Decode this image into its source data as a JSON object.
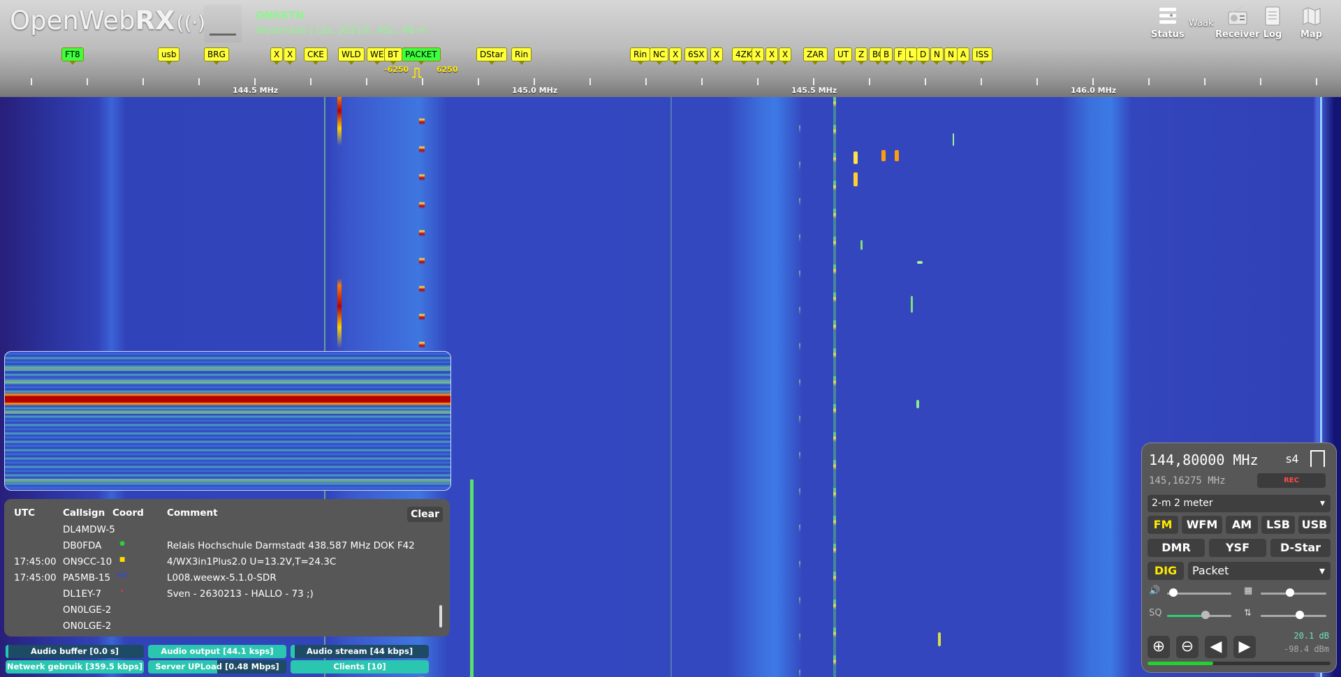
{
  "header": {
    "logo_light": "Open",
    "logo_web": "Web",
    "logo_bold": "RX",
    "logo_icon": "((·))",
    "station_name": "ON6STN",
    "station_location": "Westmalle | Loc: JO21ih, ASL: 48 m",
    "weather": "Waak",
    "buttons": [
      {
        "label": "Status",
        "icon": "status-icon"
      },
      {
        "label": "Receiver",
        "icon": "receiver-icon"
      },
      {
        "label": "Log",
        "icon": "log-icon"
      },
      {
        "label": "Map",
        "icon": "map-icon"
      }
    ]
  },
  "scale": {
    "bookmarks": [
      {
        "label": "FT8",
        "color": "#3dff3d"
      },
      {
        "label": "usb",
        "color": "#ffff3a"
      },
      {
        "label": "BRG",
        "color": "#ffff3a"
      },
      {
        "label": "X",
        "color": "#ffff3a"
      },
      {
        "label": "X",
        "color": "#ffff3a"
      },
      {
        "label": "CKE",
        "color": "#ffff3a"
      },
      {
        "label": "WLD",
        "color": "#ffff3a"
      },
      {
        "label": "WE",
        "color": "#ffff3a"
      },
      {
        "label": "BT",
        "color": "#ffff3a"
      },
      {
        "label": "PACKET",
        "color": "#3dff3d"
      },
      {
        "label": "DStar",
        "color": "#ffff3a"
      },
      {
        "label": "Rin",
        "color": "#ffff3a"
      },
      {
        "label": "Rin",
        "color": "#ffff3a"
      },
      {
        "label": "NC",
        "color": "#ffff3a"
      },
      {
        "label": "X",
        "color": "#ffff3a"
      },
      {
        "label": "6SX",
        "color": "#ffff3a"
      },
      {
        "label": "X",
        "color": "#ffff3a"
      },
      {
        "label": "4ZK",
        "color": "#ffff3a"
      },
      {
        "label": "X",
        "color": "#ffff3a"
      },
      {
        "label": "X",
        "color": "#ffff3a"
      },
      {
        "label": "X",
        "color": "#ffff3a"
      },
      {
        "label": "ZAR",
        "color": "#ffff3a"
      },
      {
        "label": "UT",
        "color": "#ffff3a"
      },
      {
        "label": "Z",
        "color": "#ffff3a"
      },
      {
        "label": "BC",
        "color": "#ffff3a"
      },
      {
        "label": "B",
        "color": "#ffff3a"
      },
      {
        "label": "F",
        "color": "#ffff3a"
      },
      {
        "label": "L",
        "color": "#ffff3a"
      },
      {
        "label": "D",
        "color": "#ffff3a"
      },
      {
        "label": "N",
        "color": "#ffff3a"
      },
      {
        "label": "N",
        "color": "#ffff3a"
      },
      {
        "label": "A",
        "color": "#ffff3a"
      },
      {
        "label": "ISS",
        "color": "#ffff3a"
      }
    ],
    "passband_low": "-6250",
    "passband_high": "6250",
    "freq_labels": [
      "144.5 MHz",
      "145.0 MHz",
      "145.5 MHz",
      "146.0 MHz"
    ]
  },
  "log": {
    "headers": {
      "utc": "UTC",
      "callsign": "Callsign",
      "coord": "Coord",
      "comment": "Comment"
    },
    "clear_label": "Clear",
    "rows": [
      {
        "utc": "",
        "callsign": "DL4MDW-5",
        "coord": "",
        "comment": ""
      },
      {
        "utc": "",
        "callsign": "DB0FDA",
        "coord": "●",
        "coord_color": "#2ecc40",
        "comment": "Relais Hochschule Darmstadt 438.587 MHz DOK F42"
      },
      {
        "utc": "17:45:00",
        "callsign": "ON9CC-10",
        "coord": "■",
        "coord_color": "#ffdc00",
        "comment": "4/WX3in1Plus2.0 U=13.2V,T=24.3C"
      },
      {
        "utc": "17:45:00",
        "callsign": "PA5MB-15",
        "coord": "WX",
        "coord_color": "#3040ff",
        "comment": "L008.weewx-5.1.0-SDR"
      },
      {
        "utc": "",
        "callsign": "DL1EY-7",
        "coord": "•",
        "coord_color": "#ff3030",
        "comment": "Sven - 2630213 - HALLO - 73 ;)"
      },
      {
        "utc": "",
        "callsign": "ON0LGE-2",
        "coord": "",
        "comment": ""
      },
      {
        "utc": "",
        "callsign": "ON0LGE-2",
        "coord": "",
        "comment": ""
      }
    ]
  },
  "status_bars": [
    {
      "label": "Audio buffer [0.0 s]",
      "level": 0.02
    },
    {
      "label": "Audio output [44.1 ksps]",
      "level": 1.0
    },
    {
      "label": "Audio stream [44 kbps]",
      "level": 0.03
    },
    {
      "label": "Netwerk gebruik [359.5 kbps]",
      "level": 1.0
    },
    {
      "label": "Server UPLoad [0.48 Mbps]",
      "level": 0.5
    },
    {
      "label": "Clients [10]",
      "level": 1.0
    }
  ],
  "receiver": {
    "frequency": "144,80000 MHz",
    "smeter": "s4",
    "offset_freq": "145,16275 MHz",
    "rec_label": "REC",
    "band_select": "2-m 2 meter",
    "modes_row1": [
      {
        "label": "FM",
        "active": true
      },
      {
        "label": "WFM",
        "active": false
      },
      {
        "label": "AM",
        "active": false
      },
      {
        "label": "LSB",
        "active": false
      },
      {
        "label": "USB",
        "active": false
      }
    ],
    "modes_row2": [
      {
        "label": "DMR",
        "active": false
      },
      {
        "label": "YSF",
        "active": false
      },
      {
        "label": "D-Star",
        "active": false
      }
    ],
    "dig_label": "DIG",
    "dig_select": "Packet",
    "sq_label": "SQ",
    "volume_level": 0.1,
    "waterfall_auto_level": 0.45,
    "squelch_level": 0.6,
    "nr_level": 0.6,
    "db_high": "20.1 dB",
    "db_low": "-98.4 dBm",
    "signal_level": 0.36,
    "buttons": [
      "zoom-in-icon",
      "zoom-out-icon",
      "step-left-icon",
      "step-right-icon"
    ]
  }
}
